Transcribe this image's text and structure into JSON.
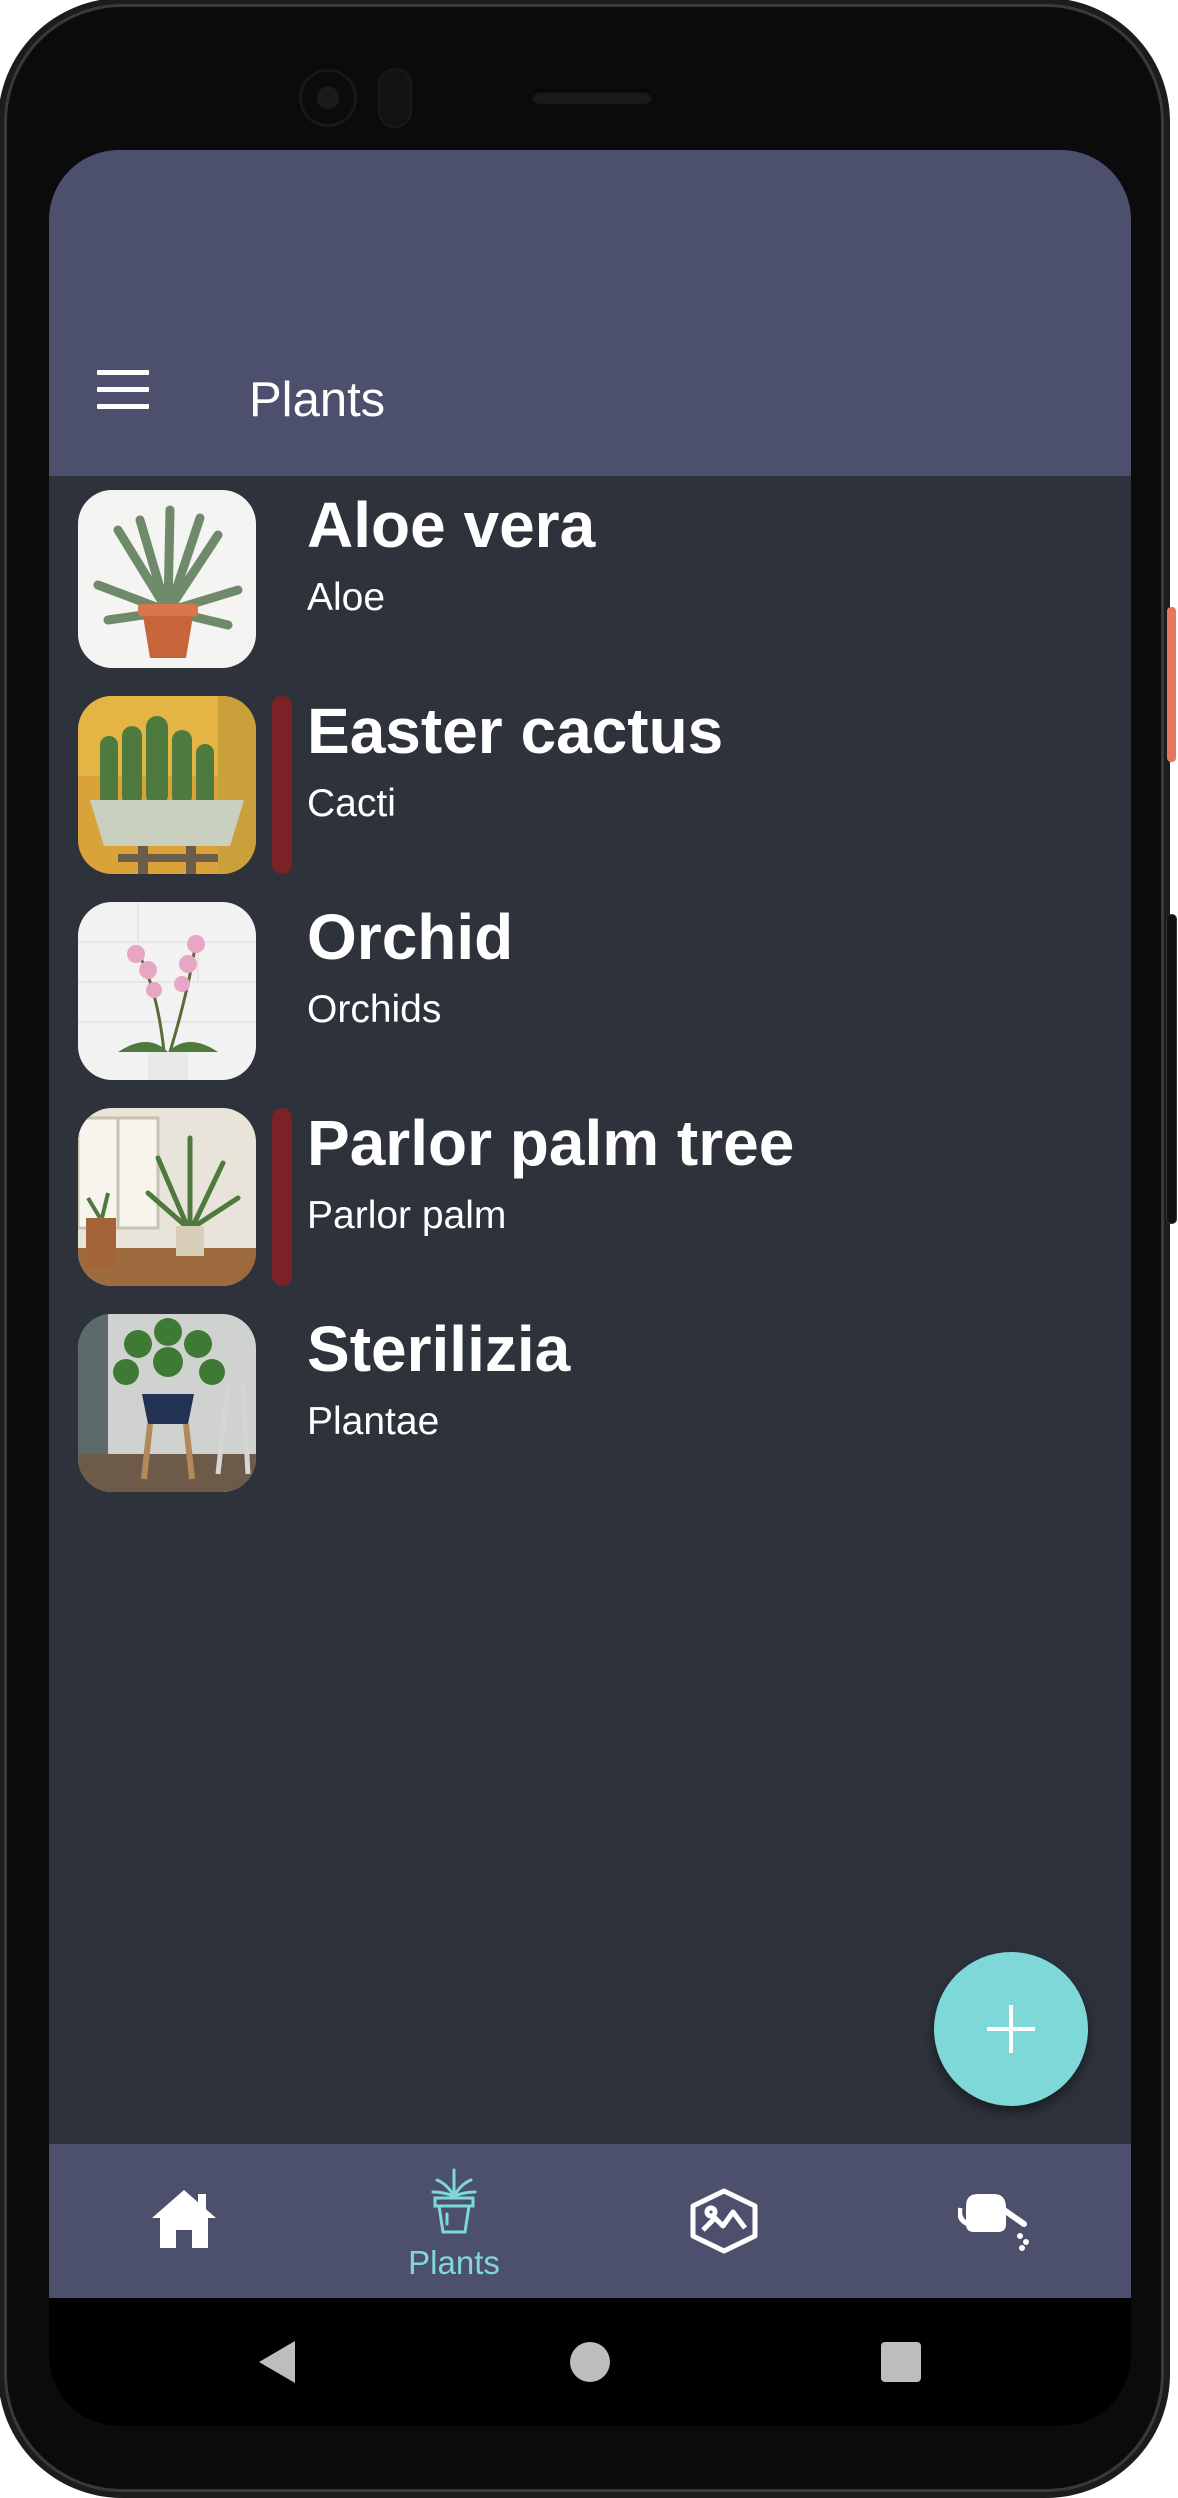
{
  "appbar": {
    "title": "Plants",
    "menu_icon": "hamburger-menu-icon"
  },
  "plants": [
    {
      "name": "Aloe vera",
      "group": "Aloe",
      "flag": false
    },
    {
      "name": "Easter cactus",
      "group": "Cacti",
      "flag": true
    },
    {
      "name": "Orchid",
      "group": "Orchids",
      "flag": false
    },
    {
      "name": "Parlor palm tree",
      "group": "Parlor palm",
      "flag": true
    },
    {
      "name": "Sterilizia",
      "group": "Plantae",
      "flag": false
    }
  ],
  "fab": {
    "icon": "plus-icon"
  },
  "bottom_nav": {
    "items": [
      {
        "icon": "home-icon",
        "label": ""
      },
      {
        "icon": "potted-plant-icon",
        "label": "Plants",
        "selected": true
      },
      {
        "icon": "landscape-box-icon",
        "label": ""
      },
      {
        "icon": "watering-can-icon",
        "label": ""
      }
    ]
  },
  "colors": {
    "appbar": "#4d506d",
    "background": "#2e323b",
    "accent": "#7fd8d8",
    "flag": "#7a2226"
  }
}
